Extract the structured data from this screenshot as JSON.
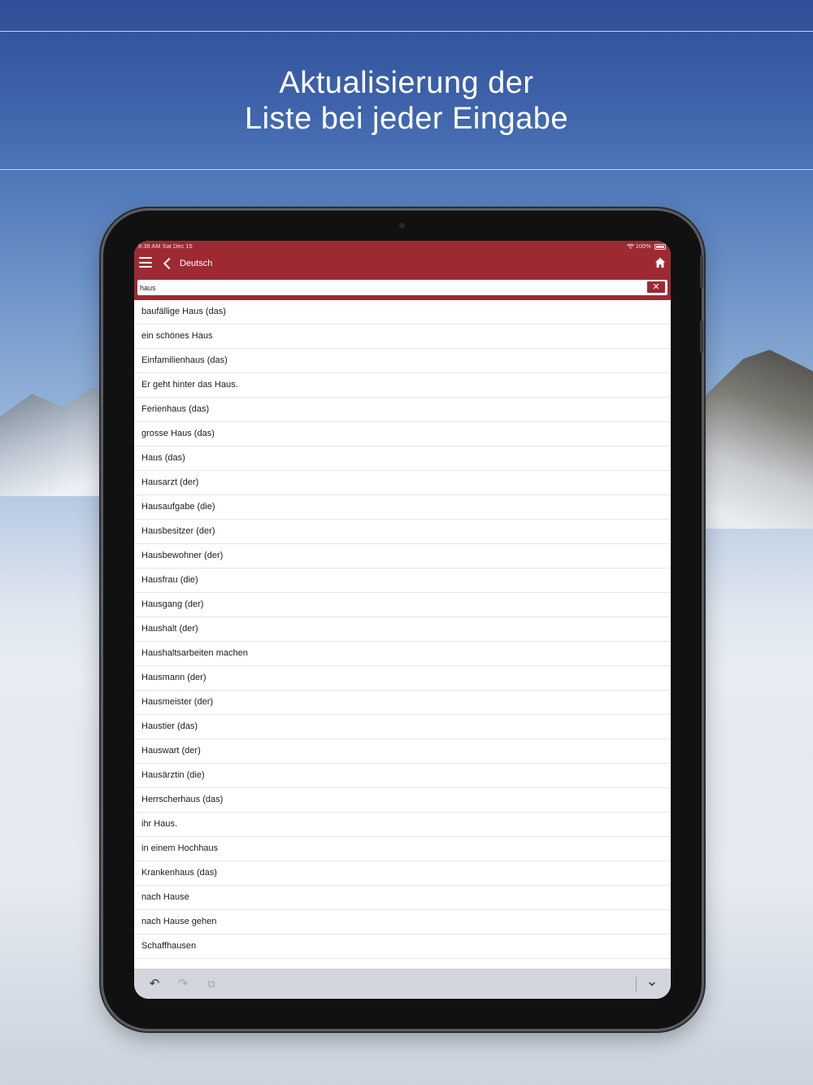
{
  "headline": {
    "line1": "Aktualisierung der",
    "line2": "Liste bei jeder Eingabe"
  },
  "status_bar": {
    "time_date": "8:38 AM   Sat Dec 15",
    "battery": "100%"
  },
  "app_bar": {
    "title": "Deutsch",
    "menu_icon": "hamburger-icon",
    "back_icon": "chevron-left-icon",
    "home_icon": "home-icon"
  },
  "search": {
    "value": "haus",
    "clear_label": "✕"
  },
  "results": [
    "baufällige Haus (das)",
    "ein schönes Haus",
    "Einfamilienhaus (das)",
    "Er geht hinter das Haus.",
    "Ferienhaus (das)",
    "grosse Haus (das)",
    "Haus (das)",
    "Hausarzt (der)",
    "Hausaufgabe (die)",
    "Hausbesitzer (der)",
    "Hausbewohner (der)",
    "Hausfrau (die)",
    "Hausgang (der)",
    "Haushalt (der)",
    "Haushaltsarbeiten machen",
    "Hausmann (der)",
    "Hausmeister (der)",
    "Haustier (das)",
    "Hauswart (der)",
    "Hausärztin (die)",
    "Herrscherhaus (das)",
    "ihr Haus.",
    "in einem Hochhaus",
    "Krankenhaus (das)",
    "nach Hause",
    "nach Hause gehen",
    "Schaffhausen"
  ],
  "keyboard_bar": {
    "undo": "↶",
    "redo": "↷",
    "paste": "⧉",
    "dismiss": "⌄"
  },
  "colors": {
    "accent": "#9d2a33"
  }
}
